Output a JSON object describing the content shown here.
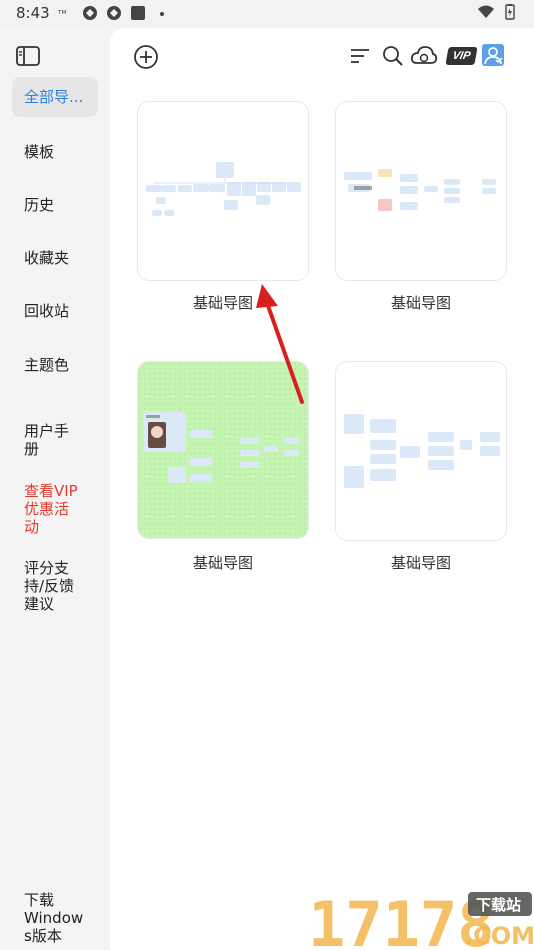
{
  "status_bar": {
    "time": "8:43"
  },
  "sidebar": {
    "items": [
      {
        "label": "全部导..."
      },
      {
        "label": "模板"
      },
      {
        "label": "历史"
      },
      {
        "label": "收藏夹"
      },
      {
        "label": "回收站"
      },
      {
        "label": "主题色"
      },
      {
        "label": "用户手\n册"
      },
      {
        "label": "查看VIP\n优惠活\n动"
      },
      {
        "label": "评分支\n持/反馈\n建议"
      },
      {
        "label": "下载\nWindow\ns版本"
      }
    ]
  },
  "toolbar": {
    "vip_badge": "VIP"
  },
  "cards": [
    {
      "label": "基础导图"
    },
    {
      "label": "基础导图"
    },
    {
      "label": "基础导图"
    },
    {
      "label": "基础导图"
    }
  ],
  "watermark": {
    "number": "17178",
    "badge": "下载站",
    "domain": ".COM"
  },
  "colors": {
    "accent": "#2f7de1",
    "vip_red": "#e23b2e",
    "node_blue": "#dbe8f8",
    "green_bg": "#c6f5b3",
    "arrow_red": "#d82020"
  }
}
